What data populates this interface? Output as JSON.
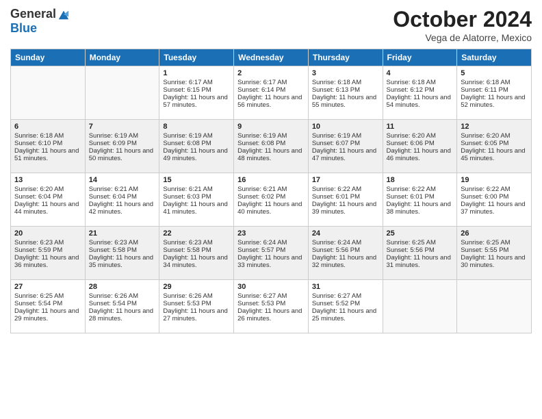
{
  "logo": {
    "general": "General",
    "blue": "Blue"
  },
  "title": "October 2024",
  "subtitle": "Vega de Alatorre, Mexico",
  "days": [
    "Sunday",
    "Monday",
    "Tuesday",
    "Wednesday",
    "Thursday",
    "Friday",
    "Saturday"
  ],
  "weeks": [
    [
      {
        "num": "",
        "sunrise": "",
        "sunset": "",
        "daylight": ""
      },
      {
        "num": "",
        "sunrise": "",
        "sunset": "",
        "daylight": ""
      },
      {
        "num": "1",
        "sunrise": "Sunrise: 6:17 AM",
        "sunset": "Sunset: 6:15 PM",
        "daylight": "Daylight: 11 hours and 57 minutes."
      },
      {
        "num": "2",
        "sunrise": "Sunrise: 6:17 AM",
        "sunset": "Sunset: 6:14 PM",
        "daylight": "Daylight: 11 hours and 56 minutes."
      },
      {
        "num": "3",
        "sunrise": "Sunrise: 6:18 AM",
        "sunset": "Sunset: 6:13 PM",
        "daylight": "Daylight: 11 hours and 55 minutes."
      },
      {
        "num": "4",
        "sunrise": "Sunrise: 6:18 AM",
        "sunset": "Sunset: 6:12 PM",
        "daylight": "Daylight: 11 hours and 54 minutes."
      },
      {
        "num": "5",
        "sunrise": "Sunrise: 6:18 AM",
        "sunset": "Sunset: 6:11 PM",
        "daylight": "Daylight: 11 hours and 52 minutes."
      }
    ],
    [
      {
        "num": "6",
        "sunrise": "Sunrise: 6:18 AM",
        "sunset": "Sunset: 6:10 PM",
        "daylight": "Daylight: 11 hours and 51 minutes."
      },
      {
        "num": "7",
        "sunrise": "Sunrise: 6:19 AM",
        "sunset": "Sunset: 6:09 PM",
        "daylight": "Daylight: 11 hours and 50 minutes."
      },
      {
        "num": "8",
        "sunrise": "Sunrise: 6:19 AM",
        "sunset": "Sunset: 6:08 PM",
        "daylight": "Daylight: 11 hours and 49 minutes."
      },
      {
        "num": "9",
        "sunrise": "Sunrise: 6:19 AM",
        "sunset": "Sunset: 6:08 PM",
        "daylight": "Daylight: 11 hours and 48 minutes."
      },
      {
        "num": "10",
        "sunrise": "Sunrise: 6:19 AM",
        "sunset": "Sunset: 6:07 PM",
        "daylight": "Daylight: 11 hours and 47 minutes."
      },
      {
        "num": "11",
        "sunrise": "Sunrise: 6:20 AM",
        "sunset": "Sunset: 6:06 PM",
        "daylight": "Daylight: 11 hours and 46 minutes."
      },
      {
        "num": "12",
        "sunrise": "Sunrise: 6:20 AM",
        "sunset": "Sunset: 6:05 PM",
        "daylight": "Daylight: 11 hours and 45 minutes."
      }
    ],
    [
      {
        "num": "13",
        "sunrise": "Sunrise: 6:20 AM",
        "sunset": "Sunset: 6:04 PM",
        "daylight": "Daylight: 11 hours and 44 minutes."
      },
      {
        "num": "14",
        "sunrise": "Sunrise: 6:21 AM",
        "sunset": "Sunset: 6:04 PM",
        "daylight": "Daylight: 11 hours and 42 minutes."
      },
      {
        "num": "15",
        "sunrise": "Sunrise: 6:21 AM",
        "sunset": "Sunset: 6:03 PM",
        "daylight": "Daylight: 11 hours and 41 minutes."
      },
      {
        "num": "16",
        "sunrise": "Sunrise: 6:21 AM",
        "sunset": "Sunset: 6:02 PM",
        "daylight": "Daylight: 11 hours and 40 minutes."
      },
      {
        "num": "17",
        "sunrise": "Sunrise: 6:22 AM",
        "sunset": "Sunset: 6:01 PM",
        "daylight": "Daylight: 11 hours and 39 minutes."
      },
      {
        "num": "18",
        "sunrise": "Sunrise: 6:22 AM",
        "sunset": "Sunset: 6:01 PM",
        "daylight": "Daylight: 11 hours and 38 minutes."
      },
      {
        "num": "19",
        "sunrise": "Sunrise: 6:22 AM",
        "sunset": "Sunset: 6:00 PM",
        "daylight": "Daylight: 11 hours and 37 minutes."
      }
    ],
    [
      {
        "num": "20",
        "sunrise": "Sunrise: 6:23 AM",
        "sunset": "Sunset: 5:59 PM",
        "daylight": "Daylight: 11 hours and 36 minutes."
      },
      {
        "num": "21",
        "sunrise": "Sunrise: 6:23 AM",
        "sunset": "Sunset: 5:58 PM",
        "daylight": "Daylight: 11 hours and 35 minutes."
      },
      {
        "num": "22",
        "sunrise": "Sunrise: 6:23 AM",
        "sunset": "Sunset: 5:58 PM",
        "daylight": "Daylight: 11 hours and 34 minutes."
      },
      {
        "num": "23",
        "sunrise": "Sunrise: 6:24 AM",
        "sunset": "Sunset: 5:57 PM",
        "daylight": "Daylight: 11 hours and 33 minutes."
      },
      {
        "num": "24",
        "sunrise": "Sunrise: 6:24 AM",
        "sunset": "Sunset: 5:56 PM",
        "daylight": "Daylight: 11 hours and 32 minutes."
      },
      {
        "num": "25",
        "sunrise": "Sunrise: 6:25 AM",
        "sunset": "Sunset: 5:56 PM",
        "daylight": "Daylight: 11 hours and 31 minutes."
      },
      {
        "num": "26",
        "sunrise": "Sunrise: 6:25 AM",
        "sunset": "Sunset: 5:55 PM",
        "daylight": "Daylight: 11 hours and 30 minutes."
      }
    ],
    [
      {
        "num": "27",
        "sunrise": "Sunrise: 6:25 AM",
        "sunset": "Sunset: 5:54 PM",
        "daylight": "Daylight: 11 hours and 29 minutes."
      },
      {
        "num": "28",
        "sunrise": "Sunrise: 6:26 AM",
        "sunset": "Sunset: 5:54 PM",
        "daylight": "Daylight: 11 hours and 28 minutes."
      },
      {
        "num": "29",
        "sunrise": "Sunrise: 6:26 AM",
        "sunset": "Sunset: 5:53 PM",
        "daylight": "Daylight: 11 hours and 27 minutes."
      },
      {
        "num": "30",
        "sunrise": "Sunrise: 6:27 AM",
        "sunset": "Sunset: 5:53 PM",
        "daylight": "Daylight: 11 hours and 26 minutes."
      },
      {
        "num": "31",
        "sunrise": "Sunrise: 6:27 AM",
        "sunset": "Sunset: 5:52 PM",
        "daylight": "Daylight: 11 hours and 25 minutes."
      },
      {
        "num": "",
        "sunrise": "",
        "sunset": "",
        "daylight": ""
      },
      {
        "num": "",
        "sunrise": "",
        "sunset": "",
        "daylight": ""
      }
    ]
  ]
}
